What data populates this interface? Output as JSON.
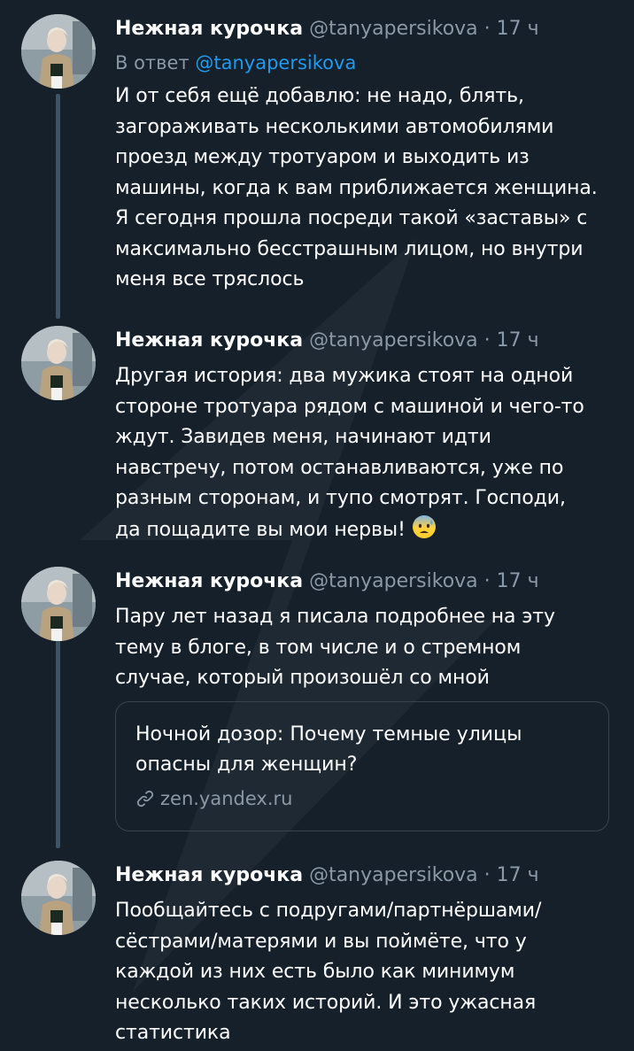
{
  "thread": {
    "tweets": [
      {
        "author_name": "Нежная курочка",
        "handle": "@tanyapersikova",
        "separator": "·",
        "time": "17 ч",
        "replying_prefix": "В ответ",
        "replying_to": "@tanyapersikova",
        "text": "И от себя ещё добавлю: не надо, блять,\nзагораживать несколькими автомобилями\nпроезд между тротуаром и выходить из\nмашины, когда к вам приближается женщина.\nЯ сегодня прошла посреди такой «заставы» с\nмаксимально бесстрашным лицом, но внутри\nменя все тряслось"
      },
      {
        "author_name": "Нежная курочка",
        "handle": "@tanyapersikova",
        "separator": "·",
        "time": "17 ч",
        "text": "Другая история: два мужика стоят на одной\nстороне тротуара рядом с машиной и чего-то\nждут. Завидев меня, начинают идти\nнавстречу, потом останавливаются, уже по\nразным сторонам, и тупо смотрят. Господи,\nда пощадите вы мои нервы!",
        "emoji": "anxious-sweat-face-emoji"
      },
      {
        "author_name": "Нежная курочка",
        "handle": "@tanyapersikova",
        "separator": "·",
        "time": "17 ч",
        "text": "Пару лет назад я писала подробнее на эту\nтему в блоге, в том числе и о стремном\nслучае, который произошёл со мной",
        "card": {
          "title": "Ночной дозор: Почему темные улицы\nопасны для женщин?",
          "domain": "zen.yandex.ru",
          "icon": "link-icon"
        }
      },
      {
        "author_name": "Нежная курочка",
        "handle": "@tanyapersikova",
        "separator": "·",
        "time": "17 ч",
        "text": "Пообщайтесь с подругами/партнёршами/\nсёстрами/матерями и вы поймёте, что у\nкаждой из них есть было как минимум\nнесколько таких историй. И это ужасная\nстатистика"
      }
    ]
  },
  "colors": {
    "background": "#15202b",
    "text": "#ffffff",
    "secondary_text": "#8b98a5",
    "accent": "#1d9bf0",
    "thread_line": "#3d5466",
    "card_border": "#38444d"
  }
}
